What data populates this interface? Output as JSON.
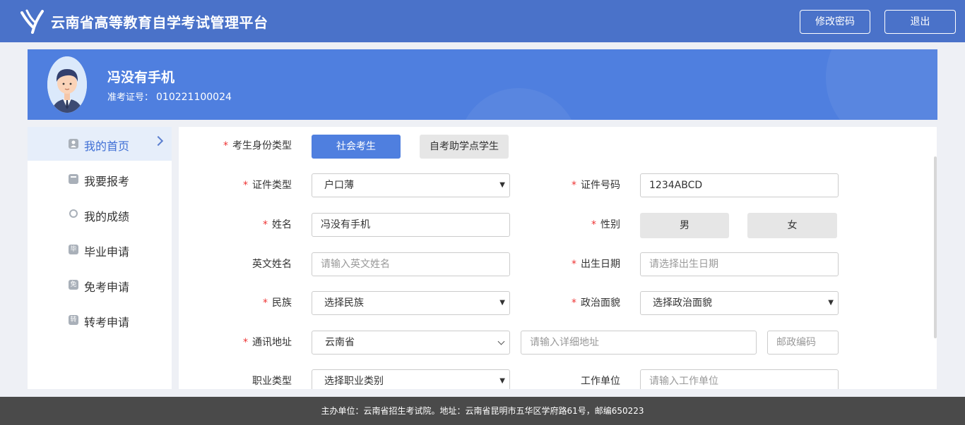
{
  "header": {
    "title": "云南省高等教育自学考试管理平台",
    "change_password": "修改密码",
    "logout": "退出"
  },
  "profile": {
    "name": "冯没有手机",
    "ticket_label": "准考证号：",
    "ticket_no": "010221100024"
  },
  "sidebar": {
    "items": [
      {
        "label": "我的首页",
        "icon": "user-icon",
        "glyph": ""
      },
      {
        "label": "我要报考",
        "icon": "book-icon",
        "glyph": ""
      },
      {
        "label": "我的成绩",
        "icon": "medal-icon",
        "glyph": ""
      },
      {
        "label": "毕业申请",
        "icon": "graduate-icon",
        "glyph": "毕"
      },
      {
        "label": "免考申请",
        "icon": "exempt-icon",
        "glyph": "免"
      },
      {
        "label": "转考申请",
        "icon": "transfer-icon",
        "glyph": "转"
      }
    ]
  },
  "form": {
    "identity_type": {
      "label": "考生身份类型",
      "options": [
        "社会考生",
        "自考助学点学生"
      ],
      "selected": "社会考生"
    },
    "id_type": {
      "label": "证件类型",
      "value": "户口薄"
    },
    "id_number": {
      "label": "证件号码",
      "value": "1234ABCD"
    },
    "name": {
      "label": "姓名",
      "value": "冯没有手机"
    },
    "gender": {
      "label": "性别",
      "options": [
        "男",
        "女"
      ]
    },
    "english_name": {
      "label": "英文姓名",
      "placeholder": "请输入英文姓名"
    },
    "birth_date": {
      "label": "出生日期",
      "placeholder": "请选择出生日期"
    },
    "ethnicity": {
      "label": "民族",
      "value": "选择民族"
    },
    "political": {
      "label": "政治面貌",
      "value": "选择政治面貌"
    },
    "address": {
      "label": "通讯地址",
      "province": "云南省",
      "detail_placeholder": "请输入详细地址",
      "postcode_placeholder": "邮政编码"
    },
    "occupation": {
      "label": "职业类型",
      "value": "选择职业类别"
    },
    "employer": {
      "label": "工作单位",
      "placeholder": "请输入工作单位"
    }
  },
  "footer": {
    "text": "主办单位：云南省招生考试院。地址：云南省昆明市五华区学府路61号，邮编650223"
  },
  "colors": {
    "primary": "#4f7fdf",
    "header": "#4a72c9",
    "required": "#e33333",
    "footer": "#4a4a4a"
  }
}
